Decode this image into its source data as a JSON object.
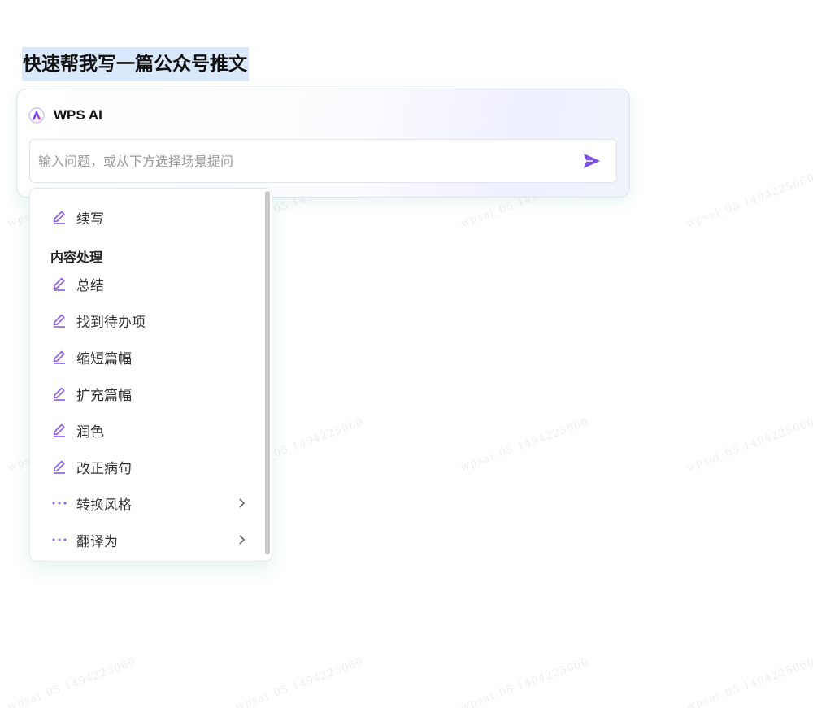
{
  "document": {
    "selected_heading": "快速帮我写一篇公众号推文"
  },
  "ai_panel": {
    "title": "WPS AI",
    "input_placeholder": "输入问题，或从下方选择场景提问",
    "input_value": "",
    "accent_color": "#7b4fe8"
  },
  "menu": {
    "top_item": {
      "label": "续写",
      "icon": "pen-icon"
    },
    "section_title": "内容处理",
    "items": [
      {
        "label": "总结",
        "icon": "pen-icon",
        "submenu": false
      },
      {
        "label": "找到待办项",
        "icon": "pen-icon",
        "submenu": false
      },
      {
        "label": "缩短篇幅",
        "icon": "pen-icon",
        "submenu": false
      },
      {
        "label": "扩充篇幅",
        "icon": "pen-icon",
        "submenu": false
      },
      {
        "label": "润色",
        "icon": "pen-icon",
        "submenu": false
      },
      {
        "label": "改正病句",
        "icon": "pen-icon",
        "submenu": false
      },
      {
        "label": "转换风格",
        "icon": "more-dots-icon",
        "submenu": true
      },
      {
        "label": "翻译为",
        "icon": "more-dots-icon",
        "submenu": true
      }
    ]
  },
  "watermark": {
    "text": "wpsai_05 1494225060"
  }
}
